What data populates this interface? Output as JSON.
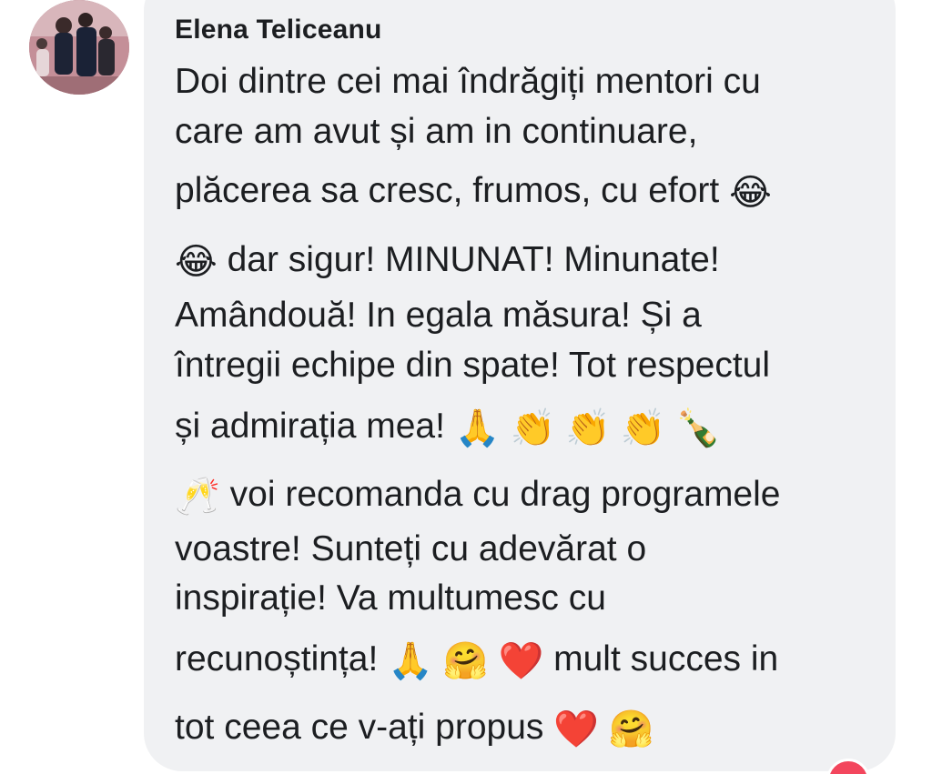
{
  "comment": {
    "author": "Elena Teliceanu",
    "lines": [
      "Doi dintre cei mai îndrăgiți mentori cu",
      "care am avut și am in continuare,",
      "plăcerea sa cresc, frumos, cu efort",
      "dar sigur! MINUNAT! Minunate!",
      "Amândouă! In egala măsura! Și a",
      "întregii echipe din spate! Tot respectul",
      "și admirația mea!",
      "voi recomanda cu drag programele",
      "voastre! Sunteți cu adevărat o",
      "inspirație! Va multumesc cu",
      "recunoștința!",
      "mult succes in",
      "tot ceea ce v-ați propus"
    ],
    "emojis": {
      "laugh": "😂",
      "pray": "🙏",
      "clap": "👏",
      "champagne": "🍾",
      "cheers": "🥂",
      "hug": "🤗",
      "heart": "❤️"
    }
  },
  "icons": {
    "avatar": "avatar-photo",
    "reaction": "love-reaction-icon"
  },
  "colors": {
    "bubble": "#f0f1f3",
    "text": "#1c1e21",
    "reaction": "#f3465d"
  }
}
